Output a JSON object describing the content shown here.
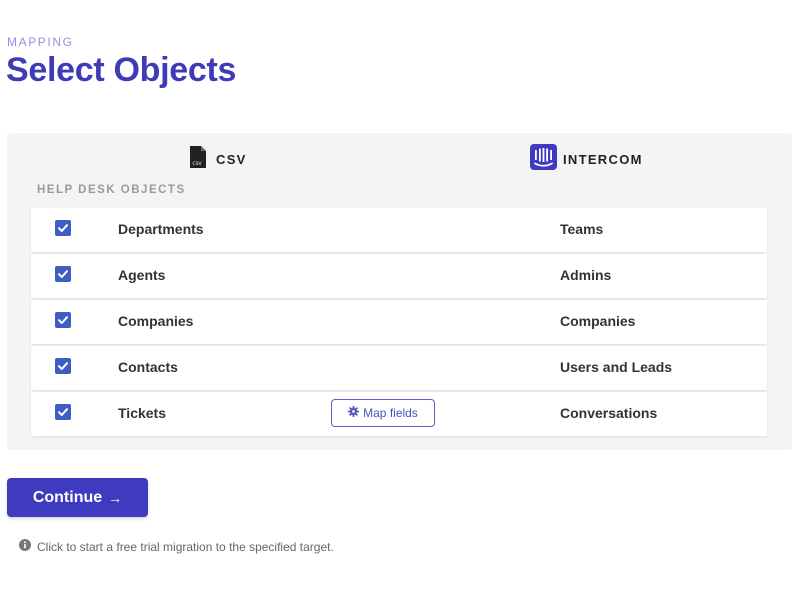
{
  "header": {
    "eyebrow": "MAPPING",
    "title": "Select Objects"
  },
  "panel": {
    "source": {
      "label": "CSV",
      "icon": "csv-file-icon"
    },
    "target": {
      "label": "INTERCOM",
      "icon": "intercom-logo-icon"
    },
    "section_label": "HELP DESK OBJECTS",
    "rows": [
      {
        "checked": true,
        "source": "Departments",
        "target": "Teams"
      },
      {
        "checked": true,
        "source": "Agents",
        "target": "Admins"
      },
      {
        "checked": true,
        "source": "Companies",
        "target": "Companies"
      },
      {
        "checked": true,
        "source": "Contacts",
        "target": "Users and Leads"
      },
      {
        "checked": true,
        "source": "Tickets",
        "target": "Conversations",
        "map_fields_label": "Map fields"
      }
    ]
  },
  "actions": {
    "continue_label": "Continue",
    "continue_arrow": "→"
  },
  "hint": "Click to start a free trial migration to the specified target.",
  "colors": {
    "brand": "#3f3bc0",
    "title": "#3e3bb5",
    "eyebrow": "#8f93e6",
    "checkbox": "#3f5ec4",
    "intercom": "#3f3bc0"
  }
}
